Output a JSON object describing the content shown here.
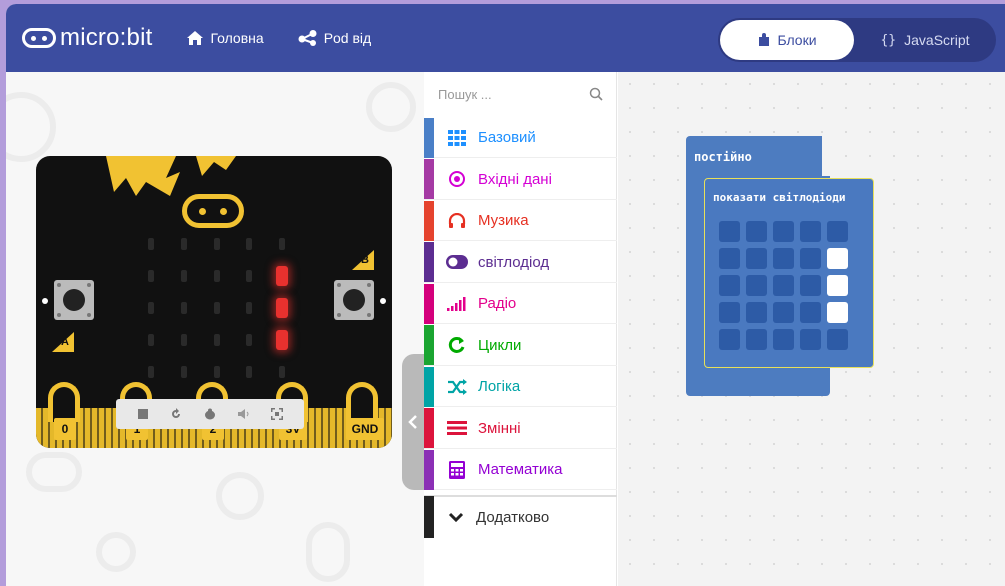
{
  "header": {
    "logo_text": "micro:bit",
    "nav": [
      {
        "label": "Головна",
        "icon": "home-icon"
      },
      {
        "label": "Pod від",
        "icon": "share-icon"
      }
    ],
    "editor_toggle": {
      "blocks_label": "Блоки",
      "js_brackets": "{}",
      "js_label": "JavaScript",
      "active": "blocks"
    }
  },
  "simulator": {
    "button_a": "A",
    "button_b": "B",
    "pins": [
      "0",
      "1",
      "2",
      "3V",
      "GND"
    ],
    "led_display": [
      [
        0,
        0,
        0,
        0,
        0
      ],
      [
        0,
        0,
        0,
        0,
        1
      ],
      [
        0,
        0,
        0,
        0,
        1
      ],
      [
        0,
        0,
        0,
        0,
        1
      ],
      [
        0,
        0,
        0,
        0,
        0
      ]
    ],
    "controls": [
      "stop-icon",
      "restart-icon",
      "debug-icon",
      "mute-icon",
      "fullscreen-icon"
    ]
  },
  "toolbox": {
    "search_placeholder": "Пошук ...",
    "categories": [
      {
        "label": "Базовий",
        "color": "#1e90ff",
        "icon": "grid-icon"
      },
      {
        "label": "Вхідні дані",
        "color": "#d400d4",
        "icon": "target-icon"
      },
      {
        "label": "Музика",
        "color": "#e63022",
        "icon": "headphones-icon"
      },
      {
        "label": "світлодіод",
        "color": "#5c2d91",
        "icon": "toggle-icon"
      },
      {
        "label": "Радіо",
        "color": "#e3008c",
        "icon": "signal-icon"
      },
      {
        "label": "Цикли",
        "color": "#00aa00",
        "icon": "loop-icon"
      },
      {
        "label": "Логіка",
        "color": "#00a4a6",
        "icon": "shuffle-icon"
      },
      {
        "label": "Змінні",
        "color": "#dc143c",
        "icon": "lines-icon"
      },
      {
        "label": "Математика",
        "color": "#9400d3",
        "icon": "calculator-icon"
      }
    ],
    "more_label": "Додатково"
  },
  "workspace": {
    "forever_label": "постійно",
    "show_leds_label": "показати світлодіоди",
    "led_grid": [
      [
        0,
        0,
        0,
        0,
        0
      ],
      [
        0,
        0,
        0,
        0,
        1
      ],
      [
        0,
        0,
        0,
        0,
        1
      ],
      [
        0,
        0,
        0,
        0,
        1
      ],
      [
        0,
        0,
        0,
        0,
        0
      ]
    ]
  },
  "colors": {
    "header_bg": "#3c4da0",
    "board_gold": "#f1c232",
    "led_on": "#e8312e",
    "block_blue": "#4d7cc0"
  }
}
